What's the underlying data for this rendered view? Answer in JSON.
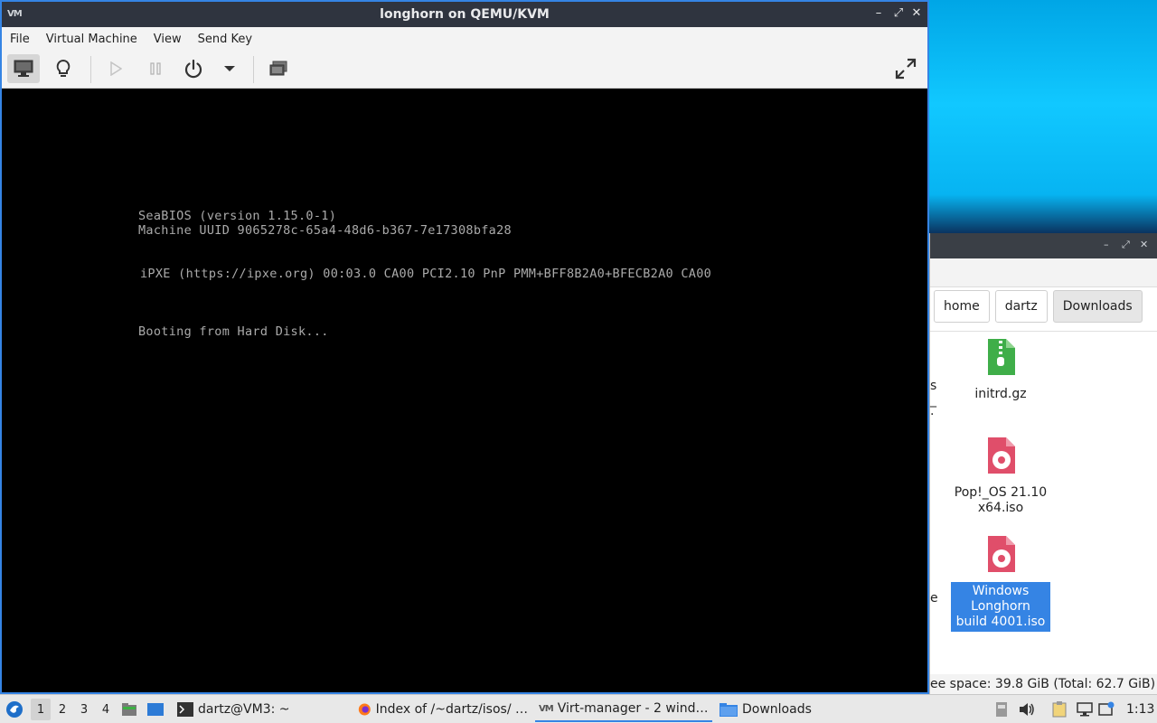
{
  "vm_window": {
    "title": "longhorn on QEMU/KVM",
    "app_icon": "VM",
    "controls": {
      "minimize": "–",
      "maximize": "⤢",
      "close": "✕"
    },
    "menu": [
      "File",
      "Virtual Machine",
      "View",
      "Send Key"
    ],
    "toolbar_icons": [
      "monitor-icon",
      "lightbulb-icon",
      "play-icon",
      "pause-icon",
      "power-icon",
      "dropdown-arrow-icon",
      "snapshots-icon",
      "fullscreen-icon"
    ],
    "console_lines": [
      "SeaBIOS (version 1.15.0-1)",
      "Machine UUID 9065278c-65a4-48d6-b367-7e17308bfa28",
      "iPXE (https://ipxe.org) 00:03.0 CA00 PCI2.10 PnP PMM+BFF8B2A0+BFECB2A0 CA00",
      "Booting from Hard Disk..."
    ]
  },
  "file_manager": {
    "breadcrumbs": [
      "home",
      "dartz",
      "Downloads"
    ],
    "files": [
      {
        "name": "initrd.gz",
        "icon": "archive-icon"
      },
      {
        "name": "Pop!_OS 21.10 x64.iso",
        "icon": "disc-image-icon"
      },
      {
        "name": "Windows Longhorn build 4001.iso",
        "icon": "disc-image-icon",
        "selected": true
      }
    ],
    "left_fragments": [
      "s",
      "_",
      ".",
      "e"
    ],
    "status": "ee space: 39.8 GiB (Total: 62.7 GiB)"
  },
  "taskbar": {
    "workspaces": [
      "1",
      "2",
      "3",
      "4"
    ],
    "tasks": [
      {
        "label": "dartz@VM3: ~",
        "icon": "terminal-icon"
      },
      {
        "label": "Index of /~dartz/isos/ …",
        "icon": "firefox-icon"
      },
      {
        "label": "Virt-manager - 2 wind…",
        "icon": "virt-manager-icon",
        "active": true
      },
      {
        "label": "Downloads",
        "icon": "folder-icon"
      }
    ],
    "clock": "1:13"
  },
  "colors": {
    "accent": "#3584e4",
    "titlebar": "#2f343f",
    "console_text": "#aaaaaa"
  }
}
